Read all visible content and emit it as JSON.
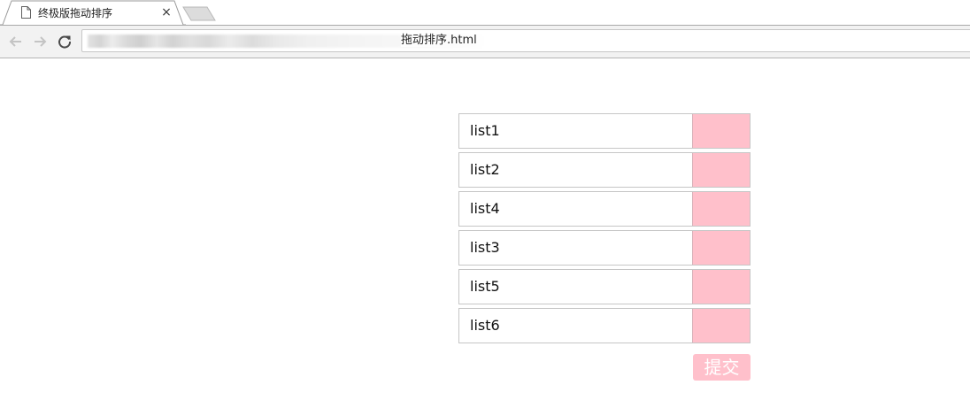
{
  "browser": {
    "tab_title": "终极版拖动排序",
    "tab_close": "×",
    "url_visible": "拖动排序.html"
  },
  "list": {
    "items": [
      {
        "label": "list1"
      },
      {
        "label": "list2"
      },
      {
        "label": "list4"
      },
      {
        "label": "list3"
      },
      {
        "label": "list5"
      },
      {
        "label": "list6"
      }
    ],
    "handle_color": "#ffc0cb"
  },
  "submit": {
    "label": "提交",
    "color": "#ffc0cb"
  },
  "icons": {
    "tab": "document-icon",
    "back": "back-arrow-icon",
    "forward": "forward-arrow-icon",
    "reload": "reload-icon"
  }
}
